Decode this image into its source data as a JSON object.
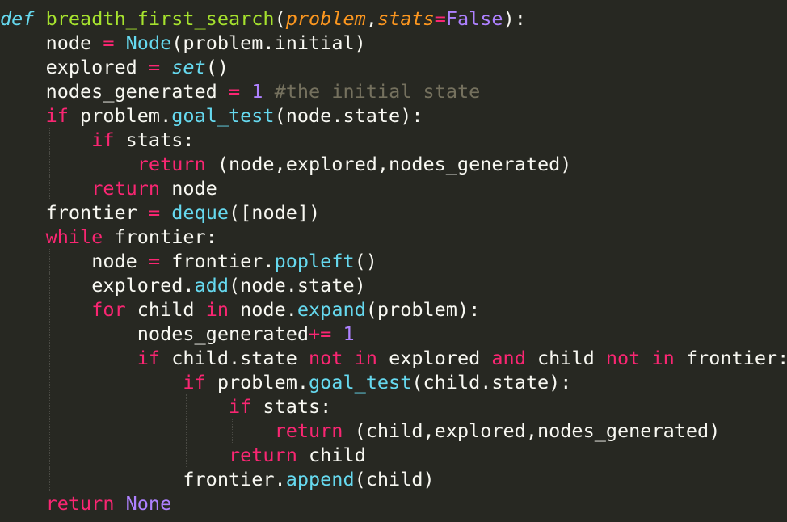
{
  "editor": {
    "indent_unit": 4,
    "lines": [
      {
        "indent": 0,
        "tokens": [
          {
            "t": "def",
            "c": "def"
          },
          {
            "t": " ",
            "c": "plain"
          },
          {
            "t": "breadth_first_search",
            "c": "fn"
          },
          {
            "t": "(",
            "c": "plain"
          },
          {
            "t": "problem",
            "c": "param"
          },
          {
            "t": ",",
            "c": "plain"
          },
          {
            "t": "stats",
            "c": "param"
          },
          {
            "t": "=",
            "c": "op"
          },
          {
            "t": "False",
            "c": "const"
          },
          {
            "t": "):",
            "c": "plain"
          }
        ]
      },
      {
        "indent": 1,
        "tokens": [
          {
            "t": "node ",
            "c": "plain"
          },
          {
            "t": "=",
            "c": "op"
          },
          {
            "t": " ",
            "c": "plain"
          },
          {
            "t": "Node",
            "c": "cls"
          },
          {
            "t": "(problem.initial)",
            "c": "plain"
          }
        ]
      },
      {
        "indent": 1,
        "tokens": [
          {
            "t": "explored ",
            "c": "plain"
          },
          {
            "t": "=",
            "c": "op"
          },
          {
            "t": " ",
            "c": "plain"
          },
          {
            "t": "set",
            "c": "builtin"
          },
          {
            "t": "()",
            "c": "plain"
          }
        ]
      },
      {
        "indent": 1,
        "tokens": [
          {
            "t": "nodes_generated ",
            "c": "plain"
          },
          {
            "t": "=",
            "c": "op"
          },
          {
            "t": " ",
            "c": "plain"
          },
          {
            "t": "1",
            "c": "num"
          },
          {
            "t": " ",
            "c": "plain"
          },
          {
            "t": "#the initial state",
            "c": "comment"
          }
        ]
      },
      {
        "indent": 1,
        "tokens": [
          {
            "t": "if",
            "c": "kw"
          },
          {
            "t": " problem.",
            "c": "plain"
          },
          {
            "t": "goal_test",
            "c": "method"
          },
          {
            "t": "(node.state):",
            "c": "plain"
          }
        ]
      },
      {
        "indent": 2,
        "tokens": [
          {
            "t": "if",
            "c": "kw"
          },
          {
            "t": " stats:",
            "c": "plain"
          }
        ]
      },
      {
        "indent": 3,
        "tokens": [
          {
            "t": "return",
            "c": "kw"
          },
          {
            "t": " (node,explored,nodes_generated)",
            "c": "plain"
          }
        ]
      },
      {
        "indent": 2,
        "tokens": [
          {
            "t": "return",
            "c": "kw"
          },
          {
            "t": " node",
            "c": "plain"
          }
        ]
      },
      {
        "indent": 1,
        "tokens": [
          {
            "t": "frontier ",
            "c": "plain"
          },
          {
            "t": "=",
            "c": "op"
          },
          {
            "t": " ",
            "c": "plain"
          },
          {
            "t": "deque",
            "c": "method"
          },
          {
            "t": "([node])",
            "c": "plain"
          }
        ]
      },
      {
        "indent": 1,
        "tokens": [
          {
            "t": "while",
            "c": "kw"
          },
          {
            "t": " frontier:",
            "c": "plain"
          }
        ]
      },
      {
        "indent": 2,
        "tokens": [
          {
            "t": "node ",
            "c": "plain"
          },
          {
            "t": "=",
            "c": "op"
          },
          {
            "t": " frontier.",
            "c": "plain"
          },
          {
            "t": "popleft",
            "c": "method"
          },
          {
            "t": "()",
            "c": "plain"
          }
        ]
      },
      {
        "indent": 2,
        "tokens": [
          {
            "t": "explored.",
            "c": "plain"
          },
          {
            "t": "add",
            "c": "method"
          },
          {
            "t": "(node.state)",
            "c": "plain"
          }
        ]
      },
      {
        "indent": 2,
        "tokens": [
          {
            "t": "for",
            "c": "kw"
          },
          {
            "t": " child ",
            "c": "plain"
          },
          {
            "t": "in",
            "c": "kw"
          },
          {
            "t": " node.",
            "c": "plain"
          },
          {
            "t": "expand",
            "c": "method"
          },
          {
            "t": "(problem):",
            "c": "plain"
          }
        ]
      },
      {
        "indent": 3,
        "tokens": [
          {
            "t": "nodes_generated",
            "c": "plain"
          },
          {
            "t": "+=",
            "c": "op"
          },
          {
            "t": " ",
            "c": "plain"
          },
          {
            "t": "1",
            "c": "num"
          }
        ]
      },
      {
        "indent": 3,
        "tokens": [
          {
            "t": "if",
            "c": "kw"
          },
          {
            "t": " child.state ",
            "c": "plain"
          },
          {
            "t": "not",
            "c": "kw"
          },
          {
            "t": " ",
            "c": "plain"
          },
          {
            "t": "in",
            "c": "kw"
          },
          {
            "t": " explored ",
            "c": "plain"
          },
          {
            "t": "and",
            "c": "kw"
          },
          {
            "t": " child ",
            "c": "plain"
          },
          {
            "t": "not",
            "c": "kw"
          },
          {
            "t": " ",
            "c": "plain"
          },
          {
            "t": "in",
            "c": "kw"
          },
          {
            "t": " frontier:",
            "c": "plain"
          }
        ]
      },
      {
        "indent": 4,
        "tokens": [
          {
            "t": "if",
            "c": "kw"
          },
          {
            "t": " problem.",
            "c": "plain"
          },
          {
            "t": "goal_test",
            "c": "method"
          },
          {
            "t": "(child.state):",
            "c": "plain"
          }
        ]
      },
      {
        "indent": 5,
        "tokens": [
          {
            "t": "if",
            "c": "kw"
          },
          {
            "t": " stats:",
            "c": "plain"
          }
        ]
      },
      {
        "indent": 6,
        "tokens": [
          {
            "t": "return",
            "c": "kw"
          },
          {
            "t": " (child,explored,nodes_generated)",
            "c": "plain"
          }
        ]
      },
      {
        "indent": 5,
        "tokens": [
          {
            "t": "return",
            "c": "kw"
          },
          {
            "t": " child",
            "c": "plain"
          }
        ]
      },
      {
        "indent": 4,
        "tokens": [
          {
            "t": "frontier.",
            "c": "plain"
          },
          {
            "t": "append",
            "c": "method"
          },
          {
            "t": "(child)",
            "c": "plain"
          }
        ]
      },
      {
        "indent": 1,
        "tokens": [
          {
            "t": "return",
            "c": "kw"
          },
          {
            "t": " ",
            "c": "plain"
          },
          {
            "t": "None",
            "c": "const"
          }
        ]
      }
    ]
  },
  "theme": {
    "background": "#272822",
    "foreground": "#F8F8F2",
    "keyword": "#F92672",
    "function": "#A6E22E",
    "parameter": "#FD971F",
    "builtin": "#66D9EF",
    "constant": "#AE81FF",
    "comment": "#75715E"
  }
}
